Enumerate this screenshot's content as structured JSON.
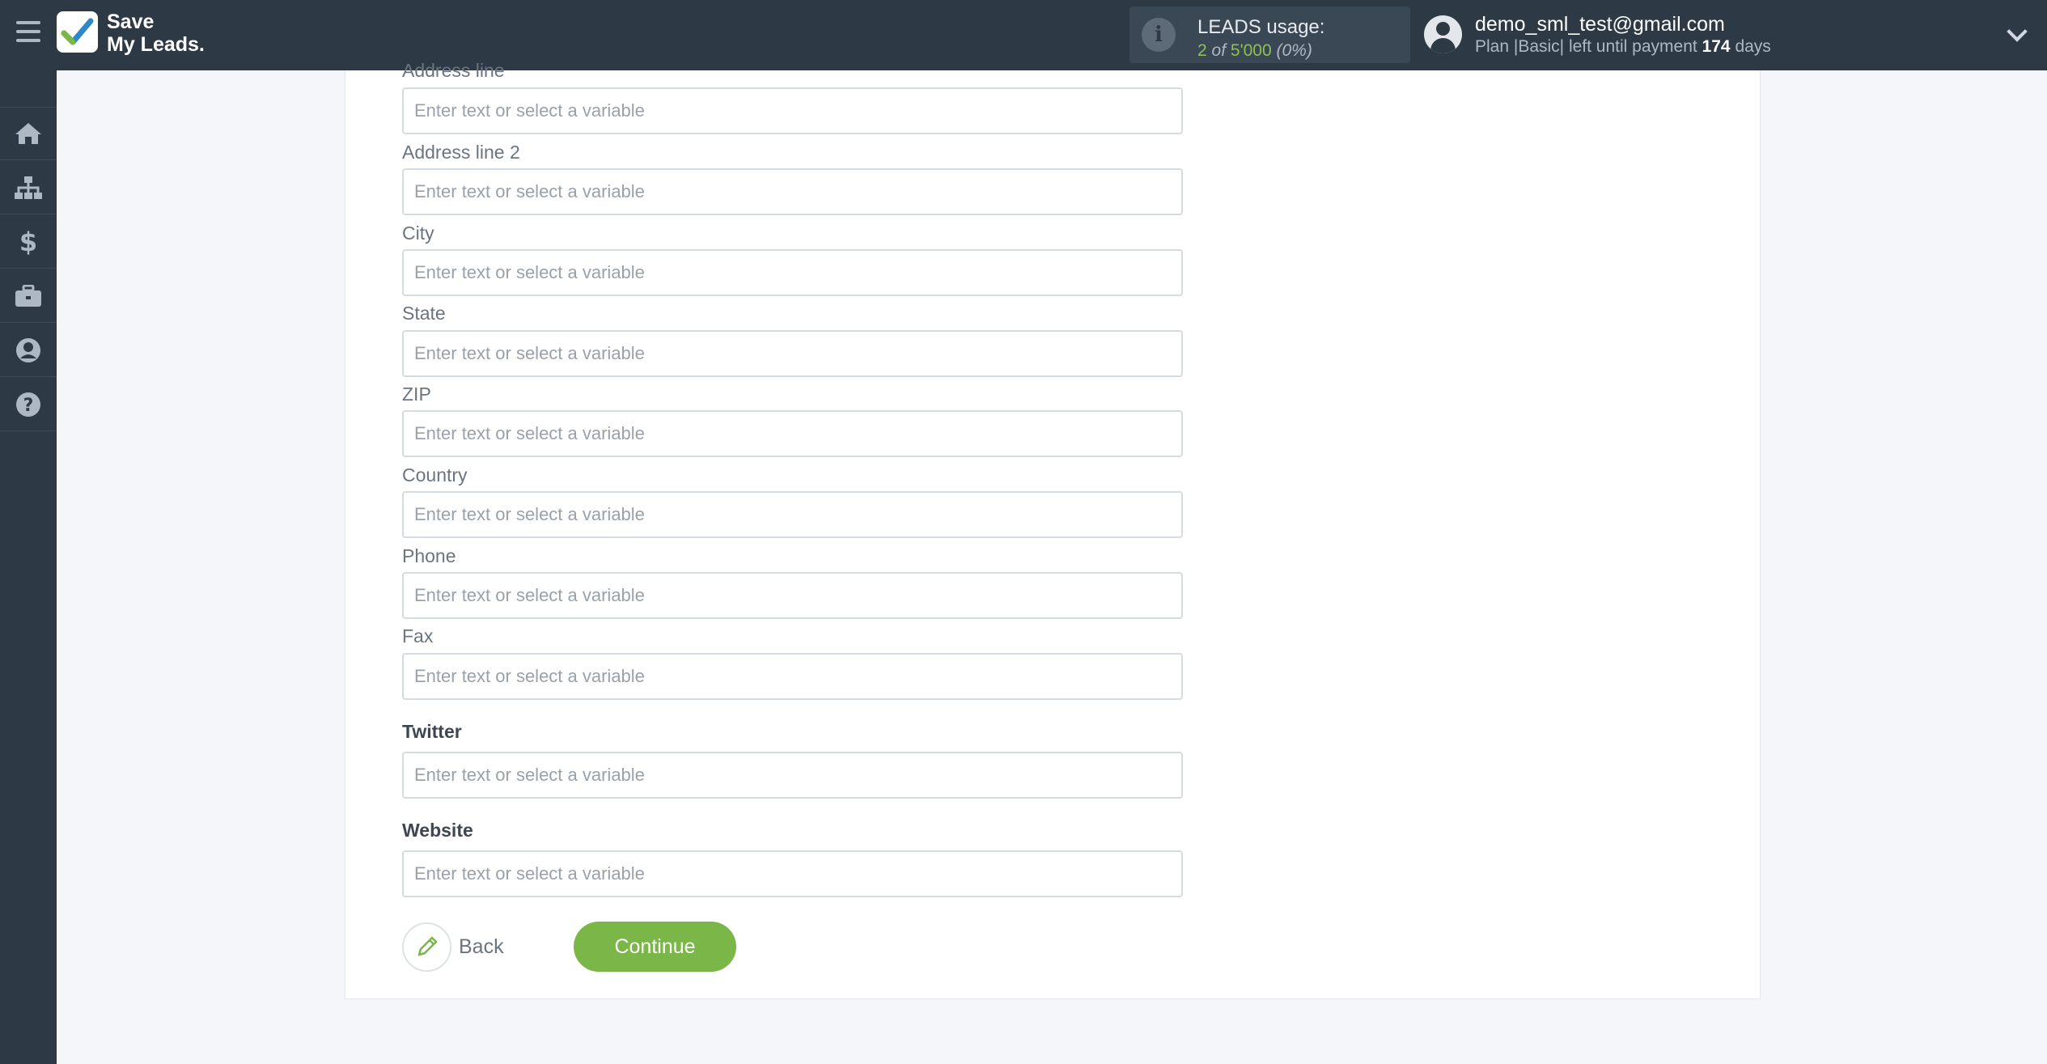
{
  "app": {
    "logo_line1": "Save",
    "logo_line2": "My Leads.",
    "brand_color": "#7ab648"
  },
  "usage": {
    "title": "LEADS usage:",
    "used": "2",
    "of": "of",
    "limit": "5'000",
    "percent": "(0%)"
  },
  "account": {
    "email": "demo_sml_test@gmail.com",
    "plan_prefix": "Plan |Basic| left until payment",
    "days": "174",
    "days_suffix": "days"
  },
  "sidebar": {
    "items": [
      {
        "icon": "home-icon"
      },
      {
        "icon": "sitemap-icon"
      },
      {
        "icon": "dollar-icon"
      },
      {
        "icon": "briefcase-icon"
      },
      {
        "icon": "user-circle-icon"
      },
      {
        "icon": "question-circle-icon"
      }
    ]
  },
  "form": {
    "placeholder": "Enter text or select a variable",
    "fields": [
      {
        "label": "Address line"
      },
      {
        "label": "Address line 2"
      },
      {
        "label": "City"
      },
      {
        "label": "State"
      },
      {
        "label": "ZIP"
      },
      {
        "label": "Country"
      },
      {
        "label": "Phone"
      },
      {
        "label": "Fax"
      },
      {
        "label": "Twitter"
      },
      {
        "label": "Website"
      }
    ]
  },
  "actions": {
    "back_label": "Back",
    "continue_label": "Continue"
  }
}
